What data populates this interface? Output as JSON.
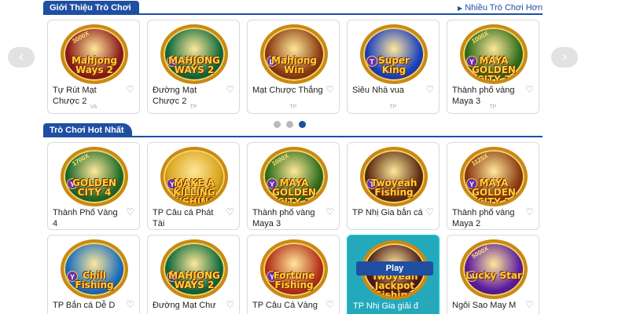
{
  "sections": {
    "intro": {
      "tab_label": "Giới Thiệu Trò Chơi",
      "more_link": "Nhiều Trò Chơi Hơn"
    },
    "hot": {
      "tab_label": "Trò Chơi Hot Nhất"
    }
  },
  "carousel": {
    "prev_icon": "‹",
    "next_icon": "›",
    "page_count": 3,
    "active_page": 3
  },
  "intro_games": [
    {
      "title": "Tự Rút Mạt Chược 2",
      "logo": "Mahjong Ways 2",
      "provider": "VA",
      "mult": "3000X",
      "theme": "#8b1a1a"
    },
    {
      "title": "Đường Mạt Chược 2",
      "logo": "MAHJONG WAYS 2",
      "provider": "TP",
      "badge": "A",
      "theme": "#0f6a3c"
    },
    {
      "title": "Mạt Chược Thắng",
      "logo": "Mahjong Win",
      "provider": "TP",
      "badge": "D",
      "theme": "#8b3a10"
    },
    {
      "title": "Siêu Nhà vua",
      "logo": "Super King",
      "provider": "TP",
      "badge": "T",
      "theme": "#1a3fbf"
    },
    {
      "title": "Thành phố vàng Maya 3",
      "logo": "MAYA GOLDEN CITY 3",
      "provider": "TP",
      "badge": "Y",
      "mult": "1000X",
      "theme": "#2f6d1a"
    }
  ],
  "hot_games": [
    {
      "title": "Thành Phố Vàng 4",
      "logo": "GOLDEN CITY 4",
      "badge": "Y",
      "mult": "1700X",
      "theme": "#1d6b2a"
    },
    {
      "title": "TP Câu cá Phát Tài",
      "logo": "MAKE A KILLING FISHING",
      "badge": "Y",
      "theme": "#d8a41a"
    },
    {
      "title": "Thành phố vàng Maya 3",
      "logo": "MAYA GOLDEN CITY 3",
      "badge": "Y",
      "mult": "1000X",
      "theme": "#2f6d1a"
    },
    {
      "title": "TP Nhị Gia bắn cá",
      "logo": "Twoyeah Fishing",
      "badge": "T",
      "theme": "#5a2a10"
    },
    {
      "title": "Thành phố vàng Maya 2",
      "logo": "MAYA GOLDEN CITY 2",
      "badge": "Y",
      "mult": "1125X",
      "theme": "#8a3a10"
    },
    {
      "title": "TP Bắn cá Dễ D",
      "logo": "Chill Fishing",
      "badge": "Y",
      "theme": "#1a6fbf"
    },
    {
      "title": "Đường Mạt Chư",
      "logo": "MAHJONG WAYS 2",
      "badge": "A",
      "theme": "#0f6a3c"
    },
    {
      "title": "TP Câu Cá Vàng",
      "logo": "Fortune Fishing",
      "badge": "Y",
      "theme": "#b3301a"
    },
    {
      "title": "TP Nhị Gia giải đ",
      "logo": "Twoyeah Jackpot Fishing",
      "play_label": "Play",
      "theme": "#4a1a1a"
    },
    {
      "title": "Ngôi Sao May M",
      "logo": "Lucky Star",
      "badge": "Y",
      "mult": "5000X",
      "theme": "#5a1aa0"
    }
  ],
  "icons": {
    "heart": "heart-icon",
    "arrow": "triangle-right-icon"
  },
  "colors": {
    "brand_blue": "#1f4fa3",
    "hover_teal": "#23a9bb",
    "gold_rim": "#c98a12"
  }
}
